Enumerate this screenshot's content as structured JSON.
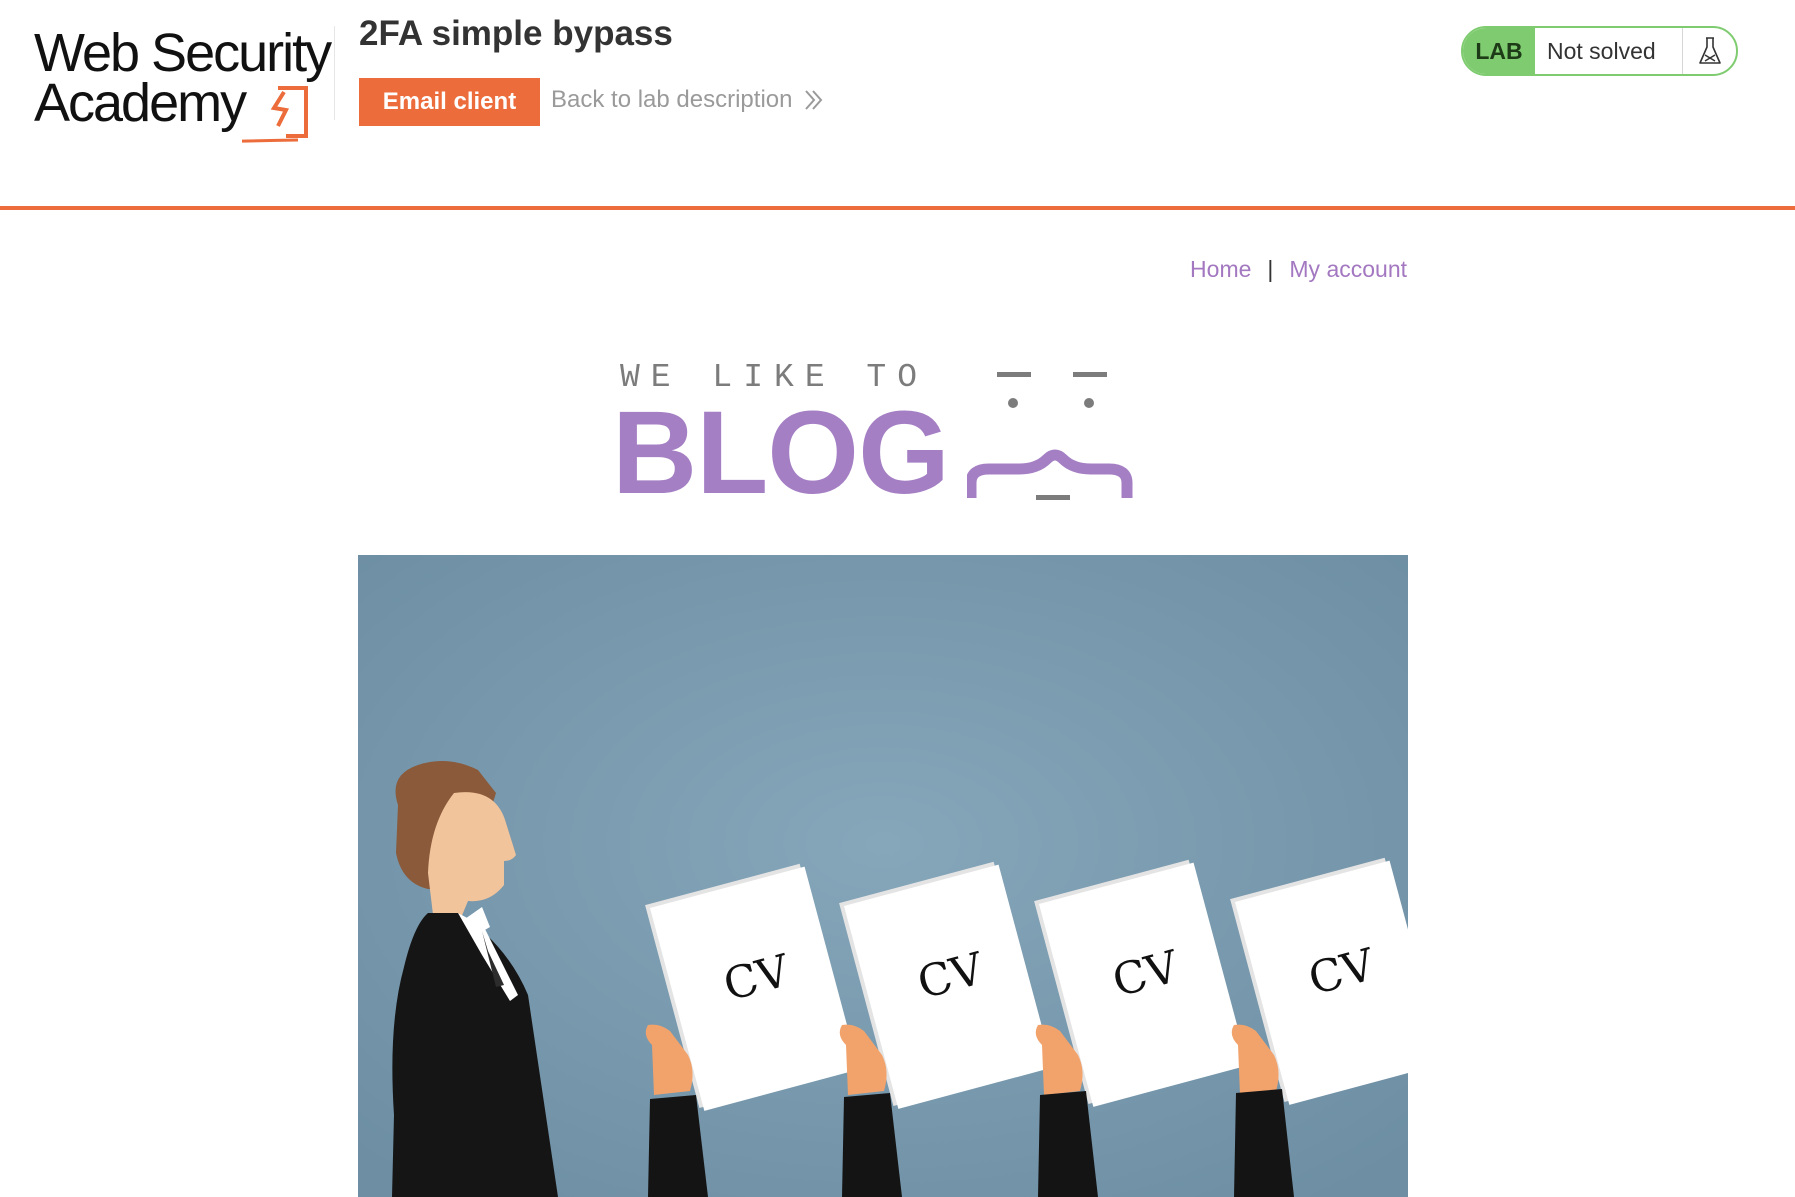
{
  "header": {
    "logo": {
      "line1": "Web Security",
      "line2": "Academy"
    },
    "lab_title": "2FA simple bypass",
    "email_button_label": "Email client",
    "back_link_label": "Back to lab description",
    "status": {
      "badge": "LAB",
      "text": "Not solved",
      "icon": "flask-icon"
    }
  },
  "nav": {
    "home_label": "Home",
    "separator": "|",
    "account_label": "My account"
  },
  "banner": {
    "tagline": "WE LIKE TO",
    "word": "BLOG"
  },
  "post_image": {
    "card_labels": [
      "CV",
      "CV",
      "CV",
      "CV"
    ]
  },
  "colors": {
    "accent_orange": "#ec6c3b",
    "brand_purple": "#a57fc4",
    "status_green": "#7fcc70",
    "image_background": "#7c9cb0"
  }
}
